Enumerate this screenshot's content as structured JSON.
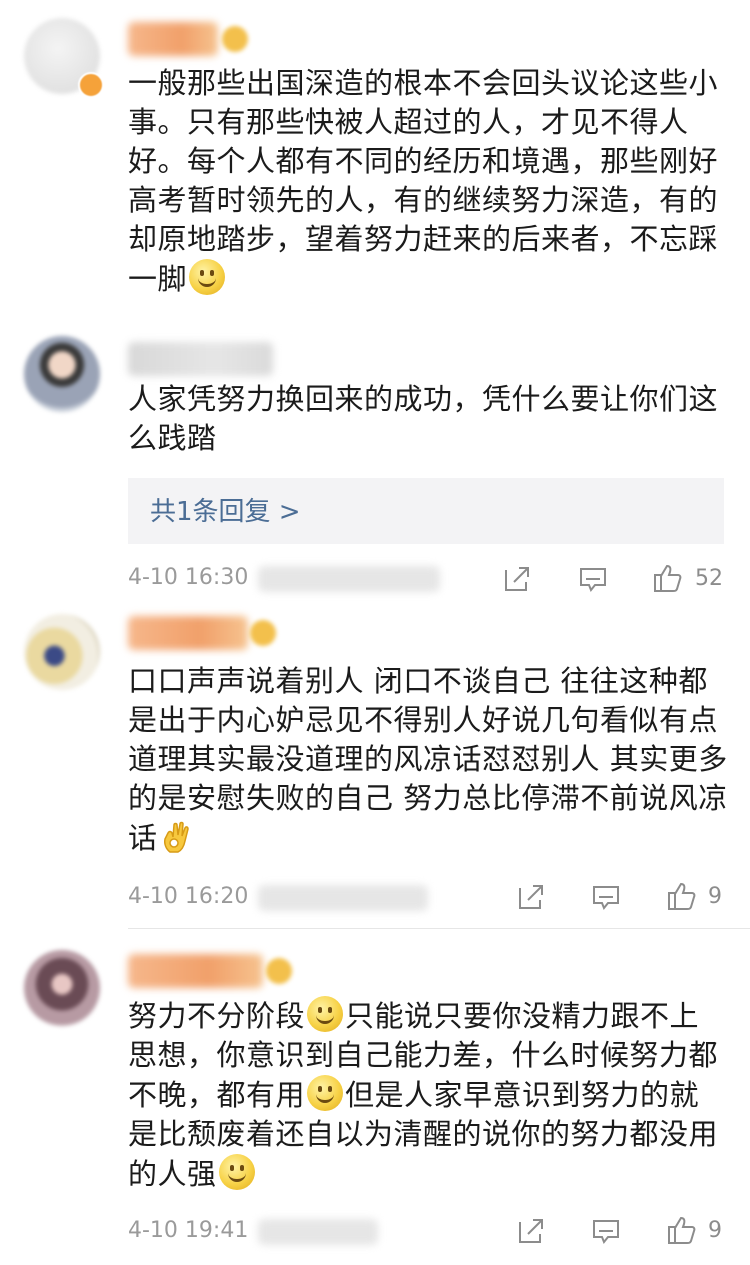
{
  "comments": [
    {
      "text": "一般那些出国深造的根本不会回头议论这些小事。只有那些快被人超过的人，才见不得人好。每个人都有不同的经历和境遇，那些刚好高考暂时领先的人，有的继续努力深造，有的却原地踏步，望着努力赶来的后来者，不忘踩一脚",
      "emoji_after": "smile-emoji"
    },
    {
      "text": "人家凭努力换回来的成功，凭什么要让你们这么践踏",
      "reply_label": "共1条回复 >",
      "time": "4-10 16:30",
      "like_count": "52"
    },
    {
      "text": "口口声声说着别人 闭口不谈自己 往往这种都是出于内心妒忌见不得别人好说几句看似有点道理其实最没道理的风凉话怼怼别人 其实更多的是安慰失败的自己 努力总比停滞不前说风凉话",
      "emoji_after": "ok-hand-emoji",
      "time": "4-10 16:20",
      "like_count": "9"
    },
    {
      "segments": [
        "努力不分阶段",
        "只能说只要你没精力跟不上思想，你意识到自己能力差，什么时候努力都不晚，都有用",
        "但是人家早意识到努力的就是比颓废着还自以为清醒的说你的努力都没用的人强"
      ],
      "time": "4-10 19:41",
      "like_count": "9"
    }
  ],
  "icons": {
    "share": "share-icon",
    "comment": "comment-icon",
    "like": "thumbs-up-icon"
  },
  "colors": {
    "link": "#4b6d95",
    "meta": "#9a9a9a",
    "username_orange": "#f1a06a"
  }
}
